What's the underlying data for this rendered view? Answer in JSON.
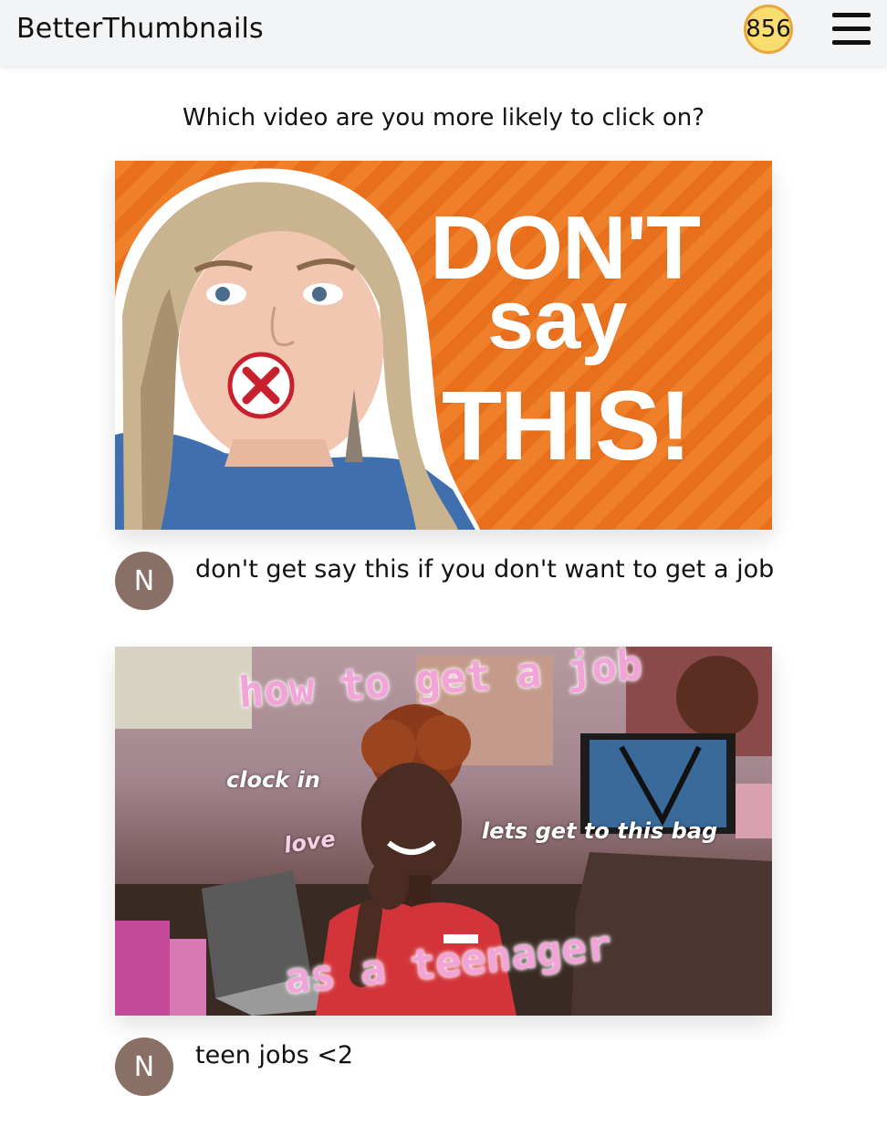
{
  "header": {
    "brand": "BetterThumbnails",
    "score": "856",
    "menu_icon": "hamburger-menu-icon"
  },
  "prompt": {
    "question": "Which video are you more likely to click on?"
  },
  "videos": [
    {
      "thumbnail_text": [
        "DON'T",
        "say",
        "THIS!"
      ],
      "avatar_letter": "N",
      "title": "don't get say this if you don't want to get a job"
    },
    {
      "thumbnail_text": {
        "top": "how to get a job",
        "clock": "clock in",
        "bag": "lets get to this bag",
        "bottom": "as a teenager",
        "love": "love"
      },
      "avatar_letter": "N",
      "title": "teen jobs <2"
    }
  ],
  "colors": {
    "topbar": "#f3f4f6",
    "score_fill": "#f7de6f",
    "score_border": "#e9a53a",
    "avatar": "#8a6f66",
    "thumb1_bg": "#f07f2a",
    "thumb2_text": "#f2a3d7"
  }
}
